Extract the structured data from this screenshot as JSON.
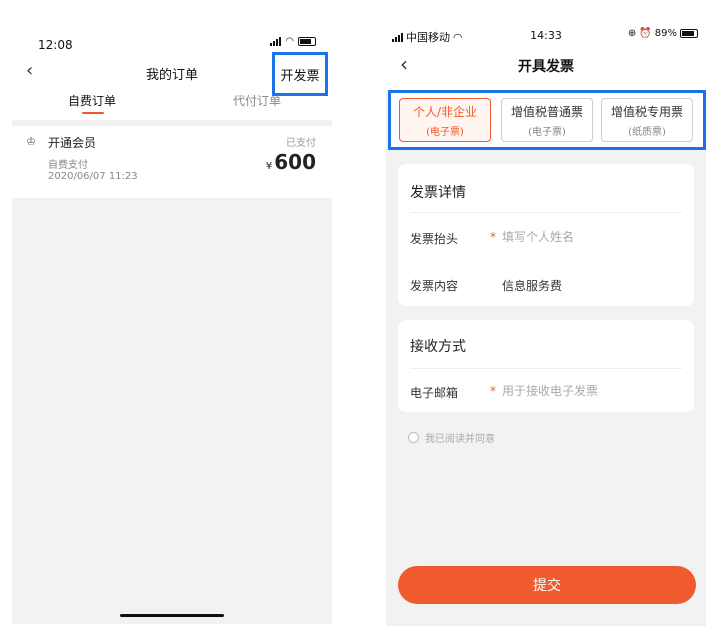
{
  "left": {
    "status": {
      "time": "12:08"
    },
    "header": {
      "title": "我的订单",
      "invoice_button": "开发票"
    },
    "tabs": [
      {
        "label": "自费订单",
        "active": true
      },
      {
        "label": "代付订单",
        "active": false
      }
    ],
    "order": {
      "name": "开通会员",
      "status": "已支付",
      "type": "自费支付",
      "date": "2020/06/07 11:23",
      "currency": "¥",
      "amount": "600"
    }
  },
  "right": {
    "status": {
      "carrier": "中国移动",
      "time": "14:33",
      "battery": "89%"
    },
    "header": {
      "title": "开具发票"
    },
    "invoice_types": [
      {
        "label": "个人/非企业",
        "sub": "(电子票)",
        "active": true
      },
      {
        "label": "增值税普通票",
        "sub": "(电子票)",
        "active": false
      },
      {
        "label": "增值税专用票",
        "sub": "(纸质票)",
        "active": false
      }
    ],
    "details": {
      "title": "发票详情",
      "header_label": "发票抬头",
      "header_placeholder": "填写个人姓名",
      "content_label": "发票内容",
      "content_value": "信息服务费"
    },
    "delivery": {
      "title": "接收方式",
      "email_label": "电子邮箱",
      "email_placeholder": "用于接收电子发票"
    },
    "agree_text": "我已阅读并同意",
    "submit": "提交"
  },
  "colors": {
    "accent": "#f05a28",
    "highlight": "#1a73e8"
  }
}
